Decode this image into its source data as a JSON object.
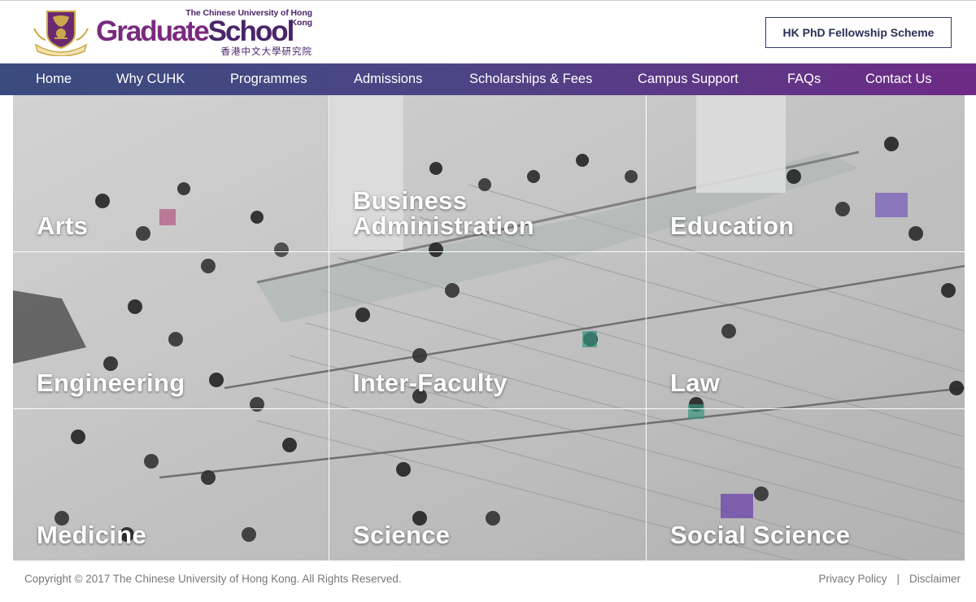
{
  "header": {
    "university_name": "The Chinese University of Hong Kong",
    "brand_graduate": "Graduate",
    "brand_school": "School",
    "brand_chinese": "香港中文大學研究院",
    "fellowship_button": "HK PhD Fellowship Scheme"
  },
  "nav": {
    "items": [
      {
        "label": "Home"
      },
      {
        "label": "Why CUHK"
      },
      {
        "label": "Programmes"
      },
      {
        "label": "Admissions"
      },
      {
        "label": "Scholarships & Fees"
      },
      {
        "label": "Campus Support"
      },
      {
        "label": "FAQs"
      },
      {
        "label": "Contact Us"
      }
    ]
  },
  "faculties": {
    "items": [
      {
        "label": "Arts"
      },
      {
        "label": "Business\nAdministration"
      },
      {
        "label": "Education"
      },
      {
        "label": "Engineering"
      },
      {
        "label": "Inter-Faculty"
      },
      {
        "label": "Law"
      },
      {
        "label": "Medicine"
      },
      {
        "label": "Science"
      },
      {
        "label": "Social Science"
      }
    ]
  },
  "footer": {
    "copyright": "Copyright © 2017 The Chinese University of Hong Kong. All Rights Reserved.",
    "privacy": "Privacy Policy",
    "separator": "|",
    "disclaimer": "Disclaimer"
  },
  "colors": {
    "brand_purple": "#7a2a7e",
    "brand_dark_purple": "#4a2468",
    "nav_start": "#3a4b7e",
    "nav_end": "#6e2a86",
    "crest_gold": "#c9a94b"
  },
  "icons": {
    "logo": "cuhk-crest-icon"
  }
}
